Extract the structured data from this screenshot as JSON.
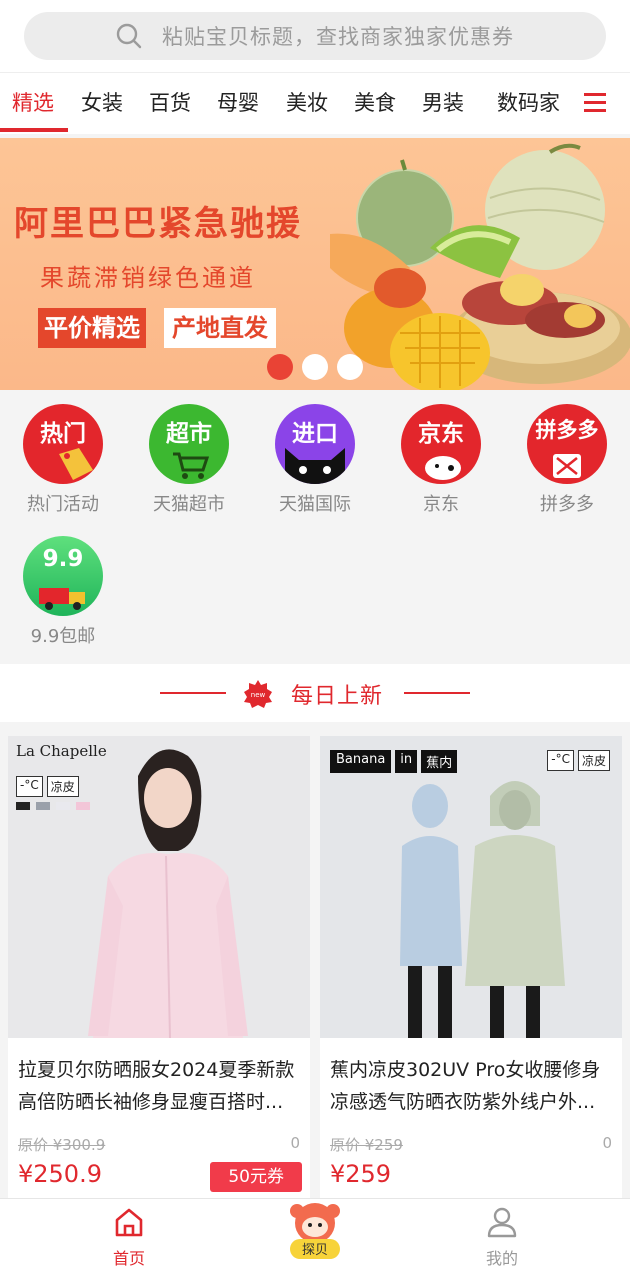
{
  "search": {
    "placeholder": "粘贴宝贝标题，查找商家独家优惠券"
  },
  "tabs": [
    {
      "label": "精选",
      "active": true
    },
    {
      "label": "女装"
    },
    {
      "label": "百货"
    },
    {
      "label": "母婴"
    },
    {
      "label": "美妆"
    },
    {
      "label": "美食"
    },
    {
      "label": "男装"
    },
    {
      "label": "数码家"
    }
  ],
  "banner": {
    "title": "阿里巴巴紧急驰援",
    "subtitle": "果蔬滞销绿色通道",
    "tag1": "平价精选",
    "tag2": "产地直发",
    "active_slide": 1,
    "slide_count": 3
  },
  "categories": [
    {
      "icon_text": "热门",
      "label": "热门活动",
      "color": "#e3262c",
      "icon": "hot-tag-icon"
    },
    {
      "icon_text": "超市",
      "label": "天猫超市",
      "color": "#3cb830",
      "icon": "cart-icon"
    },
    {
      "icon_text": "进口",
      "label": "天猫国际",
      "color": "#8b44e8",
      "icon": "cat-icon"
    },
    {
      "icon_text": "京东",
      "label": "京东",
      "color": "#e3262c",
      "icon": "dog-icon"
    },
    {
      "icon_text": "拼多多",
      "label": "拼多多",
      "color": "#e3262c",
      "icon": "gift-icon"
    },
    {
      "icon_text": "9.9",
      "label": "9.9包邮",
      "color": "#2ec46a",
      "icon": "truck-icon"
    }
  ],
  "section": {
    "badge": "new",
    "title": "每日上新"
  },
  "products": [
    {
      "brand": "La Chapelle",
      "img_tags": [
        "-°C",
        "凉皮"
      ],
      "title": "拉夏贝尔防晒服女2024夏季新款高倍防晒长袖修身显瘦百搭时...",
      "original": "原价 ¥300.9",
      "sold": "0",
      "price": "¥250.9",
      "coupon": "50元券"
    },
    {
      "brand": "Banana",
      "brand_in": "in",
      "brand_cn": "蕉内",
      "img_tags": [
        "-°C",
        "凉皮"
      ],
      "title": "蕉内凉皮302UV Pro女收腰修身凉感透气防晒衣防紫外线户外...",
      "original": "原价 ¥259",
      "sold": "0",
      "price": "¥259"
    }
  ],
  "bottom_nav": [
    {
      "label": "首页",
      "active": true,
      "icon": "home-icon"
    },
    {
      "label": "探贝",
      "icon": "mascot-icon"
    },
    {
      "label": "我的",
      "icon": "user-icon"
    }
  ],
  "colors": {
    "accent": "#e0282e",
    "banner_bg": "#fdc596"
  }
}
